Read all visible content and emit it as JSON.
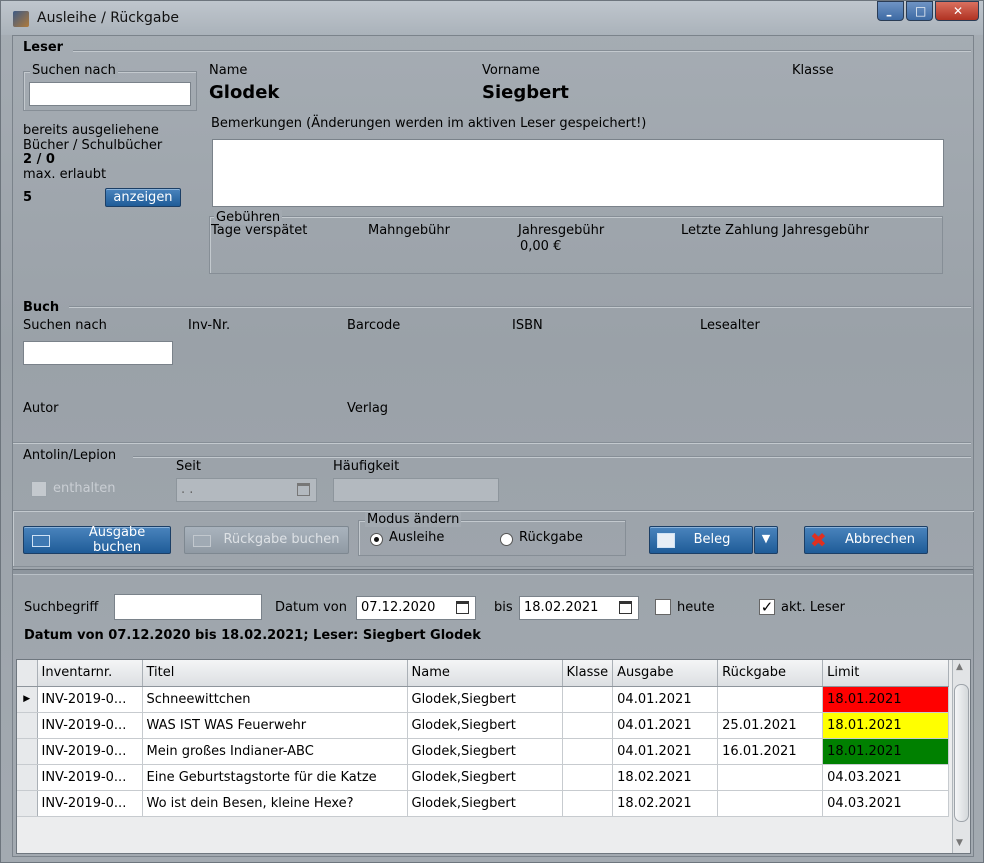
{
  "window": {
    "title": "Ausleihe / Rückgabe"
  },
  "leser": {
    "section": "Leser",
    "search_group": "Suchen nach",
    "search_value": "",
    "name_label": "Name",
    "name_value": "Glodek",
    "vorname_label": "Vorname",
    "vorname_value": "Siegbert",
    "klasse_label": "Klasse",
    "bemerkungen_label": "Bemerkungen (Änderungen werden im aktiven Leser gespeichert!)",
    "bemerkungen_value": "",
    "ausgeliehen_label1": "bereits ausgeliehene",
    "ausgeliehen_label2": "Bücher / Schulbücher",
    "ausgeliehen_value": "2 / 0",
    "max_label": "max. erlaubt",
    "max_value": "5",
    "anzeigen_button": "anzeigen",
    "gebuehren": {
      "title": "Gebühren",
      "tage_label": "Tage verspätet",
      "mahn_label": "Mahngebühr",
      "jahres_label": "Jahresgebühr",
      "jahres_value": "0,00 €",
      "letzte_label": "Letzte Zahlung Jahresgebühr"
    }
  },
  "buch": {
    "section": "Buch",
    "search_label": "Suchen nach",
    "search_value": "",
    "inv_label": "Inv-Nr.",
    "barcode_label": "Barcode",
    "isbn_label": "ISBN",
    "lesealter_label": "Lesealter",
    "autor_label": "Autor",
    "verlag_label": "Verlag"
  },
  "antolin": {
    "title": "Antolin/Lepion",
    "enthalten_label": "enthalten",
    "seit_label": "Seit",
    "seit_value": ". .",
    "haeufigkeit_label": "Häufigkeit",
    "haeufigkeit_value": ""
  },
  "actions": {
    "ausgabe_button": "Ausgabe buchen",
    "rueckgabe_button": "Rückgabe buchen",
    "modus_title": "Modus ändern",
    "modus_ausleihe": "Ausleihe",
    "modus_rueckgabe": "Rückgabe",
    "modus_selected": "Ausleihe",
    "beleg_button": "Beleg",
    "abbrechen_button": "Abbrechen"
  },
  "filter": {
    "suchbegriff_label": "Suchbegriff",
    "suchbegriff_value": "",
    "datum_von_label": "Datum von",
    "datum_von_value": "07.12.2020",
    "bis_label": "bis",
    "bis_value": "18.02.2021",
    "heute_label": "heute",
    "heute_checked": false,
    "akt_leser_label": "akt. Leser",
    "akt_leser_checked": true,
    "summary": "Datum von 07.12.2020 bis 18.02.2021; Leser: Siegbert Glodek"
  },
  "grid": {
    "columns": [
      "Inventarnr.",
      "Titel",
      "Name",
      "Klasse",
      "Ausgabe",
      "Rückgabe",
      "Limit"
    ],
    "rows": [
      {
        "inv": "INV-2019-0...",
        "titel": "Schneewittchen",
        "name": "Glodek,Siegbert",
        "klasse": "",
        "ausgabe": "04.01.2021",
        "rueckgabe": "",
        "limit": "18.01.2021",
        "limit_color": "#ff0000"
      },
      {
        "inv": "INV-2019-0...",
        "titel": "WAS IST WAS Feuerwehr",
        "name": "Glodek,Siegbert",
        "klasse": "",
        "ausgabe": "04.01.2021",
        "rueckgabe": "25.01.2021",
        "limit": "18.01.2021",
        "limit_color": "#ffff00"
      },
      {
        "inv": "INV-2019-0...",
        "titel": "Mein großes Indianer-ABC",
        "name": "Glodek,Siegbert",
        "klasse": "",
        "ausgabe": "04.01.2021",
        "rueckgabe": "16.01.2021",
        "limit": "18.01.2021",
        "limit_color": "#008000"
      },
      {
        "inv": "INV-2019-0...",
        "titel": "Eine  Geburtstagstorte für die Katze",
        "name": "Glodek,Siegbert",
        "klasse": "",
        "ausgabe": "18.02.2021",
        "rueckgabe": "",
        "limit": "04.03.2021",
        "limit_color": "#ffffff"
      },
      {
        "inv": "INV-2019-0...",
        "titel": "Wo ist dein Besen, kleine Hexe?",
        "name": "Glodek,Siegbert",
        "klasse": "",
        "ausgabe": "18.02.2021",
        "rueckgabe": "",
        "limit": "04.03.2021",
        "limit_color": "#ffffff"
      }
    ]
  }
}
